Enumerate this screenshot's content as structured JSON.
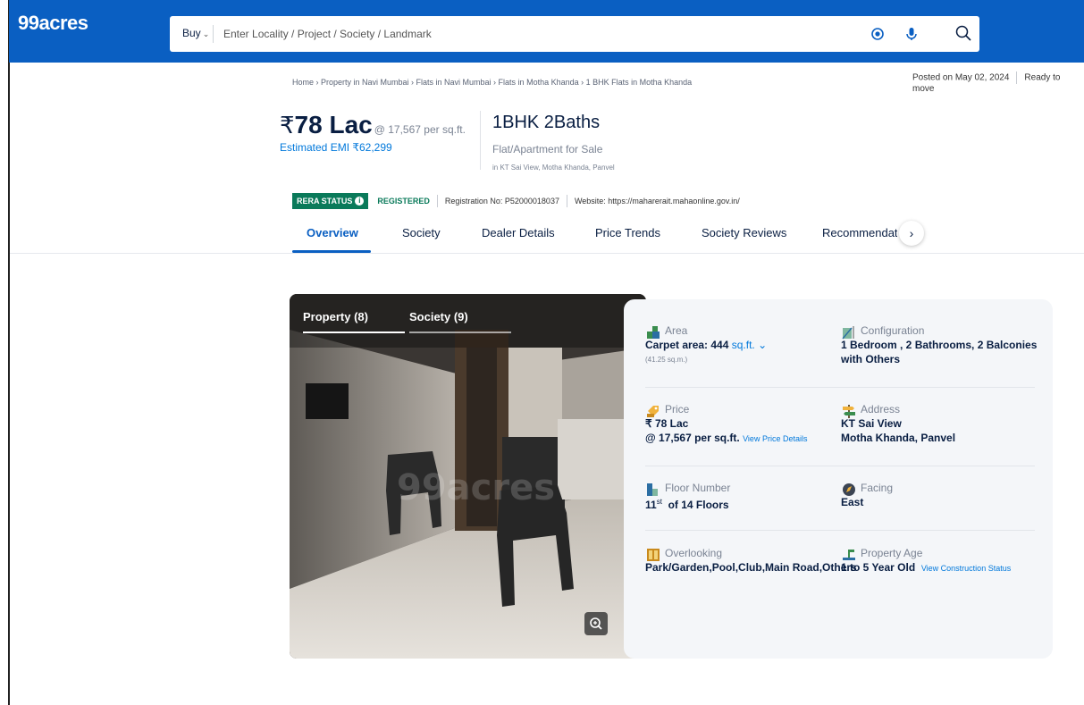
{
  "header": {
    "logo": "99acres",
    "buy_label": "Buy",
    "search_placeholder": "Enter Locality / Project / Society / Landmark"
  },
  "breadcrumb": "Home › Property in Navi Mumbai › Flats in Navi Mumbai › Flats in Motha Khanda › 1 BHK Flats in Motha Khanda",
  "posted": "Posted on May 02, 2024",
  "ready": "Ready to move",
  "listing": {
    "rupee": "₹",
    "price": "78 Lac",
    "per_sqft": "@ 17,567 per sq.ft.",
    "emi": "Estimated EMI ₹62,299",
    "config": "1BHK 2Baths",
    "type": "Flat/Apartment for Sale",
    "location": "in KT Sai View, Motha Khanda, Panvel"
  },
  "rera": {
    "status_label": "RERA STATUS",
    "status_value": "REGISTERED",
    "registration": "Registration No: P52000018037",
    "website": "Website: https://maharerait.mahaonline.gov.in/"
  },
  "tabs": [
    "Overview",
    "Society",
    "Dealer Details",
    "Price Trends",
    "Society Reviews",
    "Recommendatic"
  ],
  "gallery": {
    "tab_property": "Property (8)",
    "tab_society": "Society (9)",
    "watermark": "99acres"
  },
  "details": {
    "area": {
      "label": "Area",
      "value": "Carpet area: 444",
      "unit": "sq.ft.",
      "sub": "(41.25 sq.m.)"
    },
    "configuration": {
      "label": "Configuration",
      "value_line1": "1 Bedroom , 2 Bathrooms, 2 Balconies",
      "value_line2": "with Others"
    },
    "price": {
      "label": "Price",
      "value_line1": "₹ 78 Lac",
      "value_line2": "@ 17,567 per sq.ft.",
      "link": "View Price Details"
    },
    "address": {
      "label": "Address",
      "value_line1": "KT Sai View",
      "value_line2": "Motha Khanda, Panvel"
    },
    "floor": {
      "label": "Floor Number",
      "value": "11",
      "sup": "st",
      "value_rest": "of 14 Floors"
    },
    "facing": {
      "label": "Facing",
      "value": "East"
    },
    "overlooking": {
      "label": "Overlooking",
      "value": "Park/Garden,Pool,Club,Main Road,Others"
    },
    "age": {
      "label": "Property Age",
      "value": "1 to 5 Year Old",
      "link": "View Construction Status"
    }
  },
  "colors": {
    "brand": "#0a5fc2",
    "link": "#0078db",
    "rera_green": "#0a7a5a"
  },
  "icons": [
    "location-target-icon",
    "microphone-icon",
    "search-icon",
    "info-icon",
    "chevron-right-icon",
    "zoom-icon",
    "area-icon",
    "configuration-icon",
    "price-tag-icon",
    "address-signpost-icon",
    "floor-icon",
    "facing-compass-icon",
    "overlooking-window-icon",
    "property-age-icon"
  ]
}
